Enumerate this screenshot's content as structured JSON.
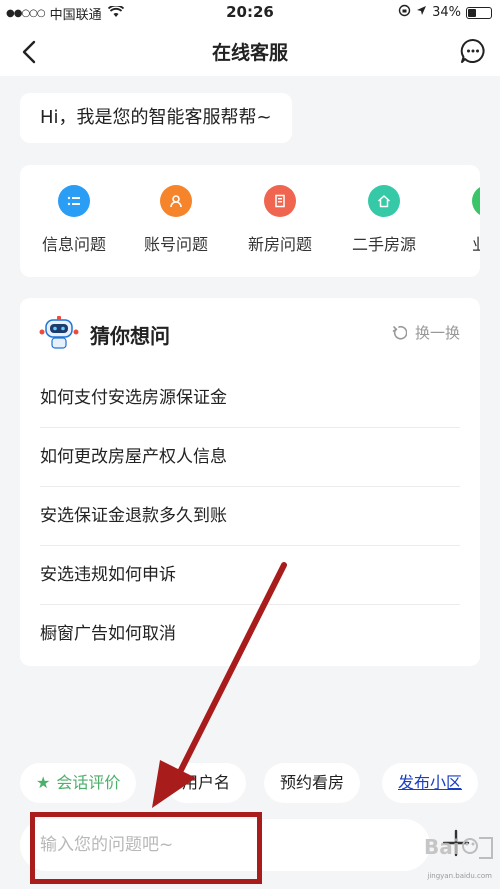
{
  "status_bar": {
    "signal_dots": "●●○○○",
    "carrier": "中国联通",
    "time": "20:26",
    "battery_percent": "34%"
  },
  "nav": {
    "title": "在线客服"
  },
  "greeting": "Hi，我是您的智能客服帮帮~",
  "categories": [
    {
      "label": "信息问题",
      "icon": "list-icon",
      "color": "#2a9df4"
    },
    {
      "label": "账号问题",
      "icon": "user-icon",
      "color": "#f5842b"
    },
    {
      "label": "新房问题",
      "icon": "building-icon",
      "color": "#f0654f"
    },
    {
      "label": "二手房源",
      "icon": "home-icon",
      "color": "#36c9a8"
    },
    {
      "label": "业主",
      "icon": "owner-icon",
      "color": "#3bc46a"
    }
  ],
  "suggest": {
    "title": "猜你想问",
    "refresh_label": "换一换",
    "questions": [
      "如何支付安选房源保证金",
      "如何更改房屋产权人信息",
      "安选保证金退款多久到账",
      "安选违规如何申诉",
      "橱窗广告如何取消"
    ]
  },
  "quick_chips": {
    "rate": "会话评价",
    "username": "用户名",
    "viewing": "预约看房",
    "publish": "发布小区"
  },
  "input": {
    "placeholder": "输入您的问题吧~"
  },
  "watermark": {
    "text": "Baidu经验",
    "url": "jingyan.baidu.com"
  },
  "colors": {
    "accent_green": "#4caf6a",
    "annotation_red": "#a81c1c",
    "link_blue": "#1a3fc0"
  }
}
